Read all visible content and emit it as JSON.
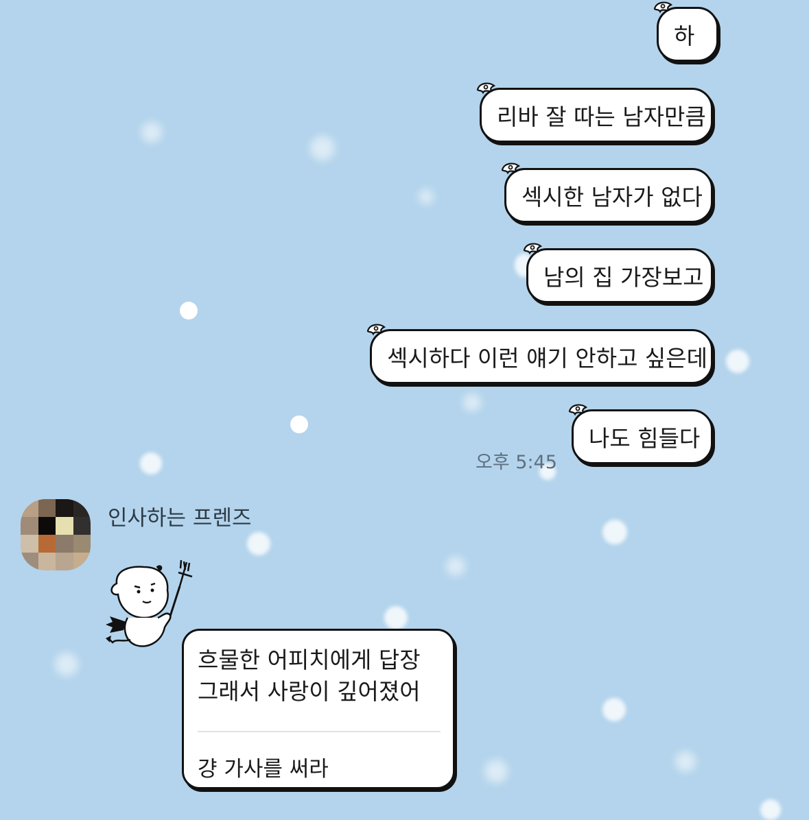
{
  "chat": {
    "outgoing": [
      {
        "text": "하"
      },
      {
        "text": "리바 잘 따는 남자만큼"
      },
      {
        "text": "섹시한 남자가 없다"
      },
      {
        "text": "남의 집 가장보고"
      },
      {
        "text": "섹시하다 이런 얘기 안하고 싶은데"
      },
      {
        "text": "나도 힘들다"
      }
    ],
    "timestamp": "오후 5:45",
    "incoming": {
      "sender": "인사하는 프렌즈",
      "sticker": "devil-sheep-sticker",
      "card": {
        "line1": "흐물한 어피치에게 답장",
        "line2": "그래서 사랑이 깊어졌어",
        "reply": "걍 가사를 써라"
      }
    }
  },
  "colors": {
    "background": "#b3d4ec",
    "bubble": "#ffffff",
    "outline": "#111111",
    "timestamp": "#5f6f80"
  }
}
